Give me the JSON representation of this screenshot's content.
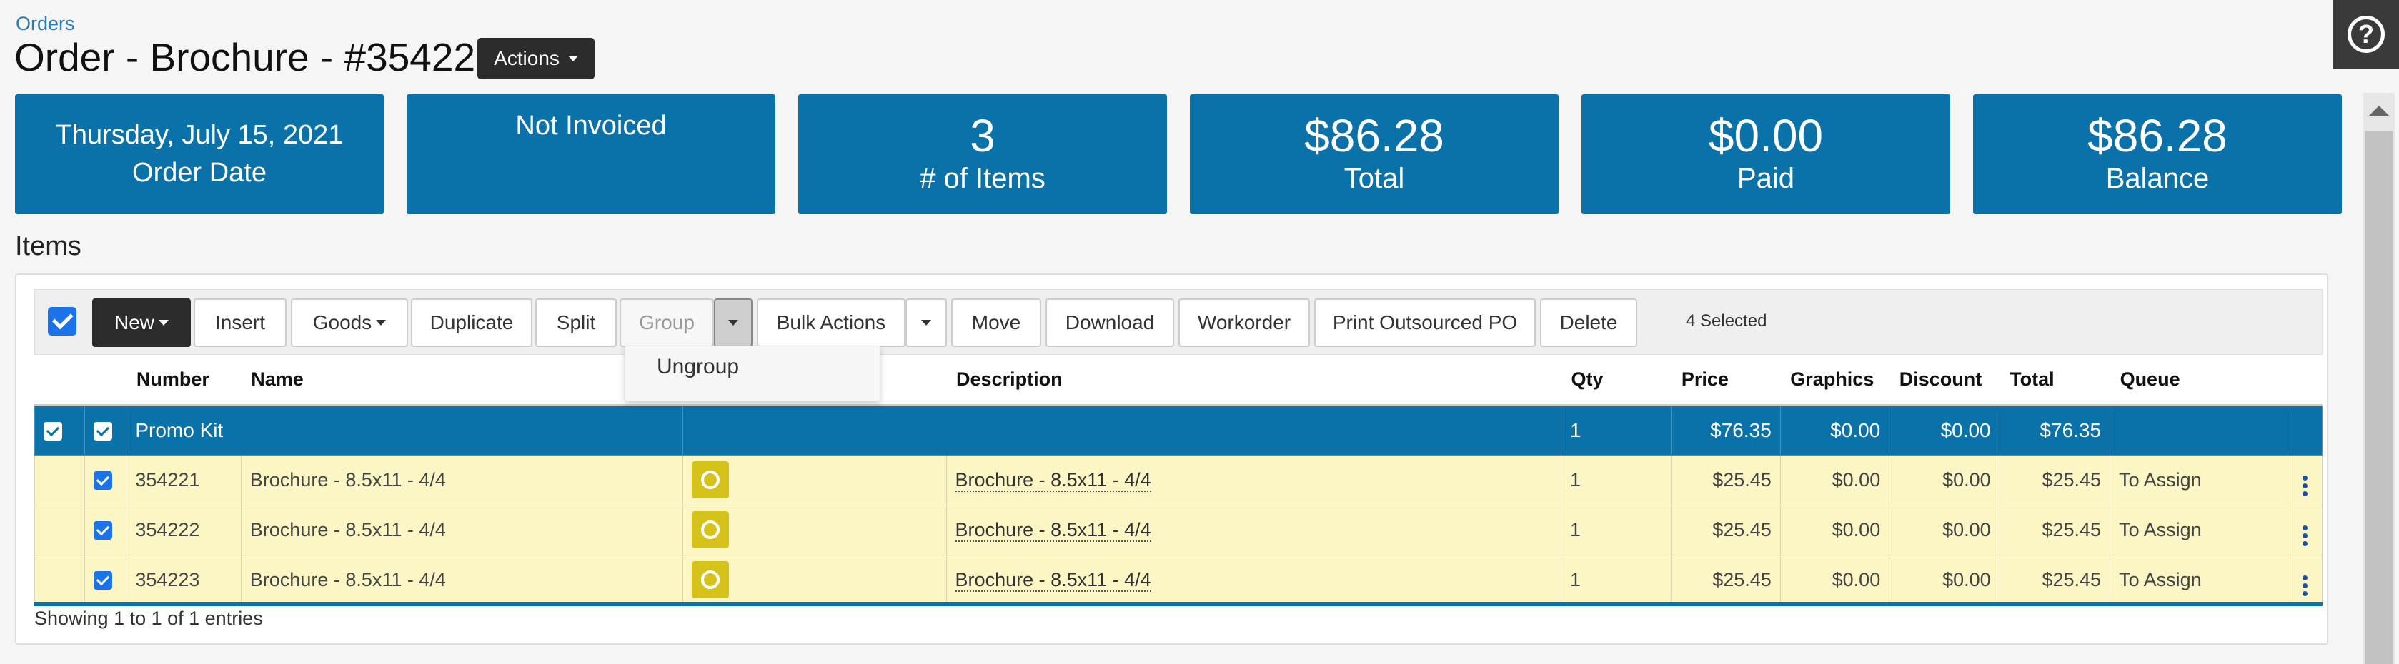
{
  "breadcrumb": "Orders",
  "title": "Order - Brochure - #35422",
  "actions_label": "Actions",
  "help_icon": "?",
  "stats": [
    {
      "line1": "Thursday, July 15, 2021",
      "line2": "Order Date"
    },
    {
      "line1": "Not Invoiced",
      "line2": ""
    },
    {
      "line1": "3",
      "line2": "# of Items"
    },
    {
      "line1": "$86.28",
      "line2": "Total"
    },
    {
      "line1": "$0.00",
      "line2": "Paid"
    },
    {
      "line1": "$86.28",
      "line2": "Balance"
    }
  ],
  "items_heading": "Items",
  "toolbar": {
    "new": "New",
    "insert": "Insert",
    "goods": "Goods",
    "duplicate": "Duplicate",
    "split": "Split",
    "group": "Group",
    "bulk_actions": "Bulk Actions",
    "move": "Move",
    "download": "Download",
    "workorder": "Workorder",
    "print_po": "Print Outsourced PO",
    "delete": "Delete",
    "selected": "4 Selected"
  },
  "dropdown": {
    "ungroup": "Ungroup"
  },
  "columns": {
    "number": "Number",
    "name": "Name",
    "description": "Description",
    "qty": "Qty",
    "price": "Price",
    "graphics": "Graphics",
    "discount": "Discount",
    "total": "Total",
    "queue": "Queue"
  },
  "group": {
    "name": "Promo Kit",
    "qty": "1",
    "price": "$76.35",
    "graphics": "$0.00",
    "discount": "$0.00",
    "total": "$76.35"
  },
  "rows": [
    {
      "number": "354221",
      "name": "Brochure - 8.5x11 - 4/4",
      "description": "Brochure - 8.5x11 - 4/4",
      "qty": "1",
      "price": "$25.45",
      "graphics": "$0.00",
      "discount": "$0.00",
      "total": "$25.45",
      "queue": "To Assign"
    },
    {
      "number": "354222",
      "name": "Brochure - 8.5x11 - 4/4",
      "description": "Brochure - 8.5x11 - 4/4",
      "qty": "1",
      "price": "$25.45",
      "graphics": "$0.00",
      "discount": "$0.00",
      "total": "$25.45",
      "queue": "To Assign"
    },
    {
      "number": "354223",
      "name": "Brochure - 8.5x11 - 4/4",
      "description": "Brochure - 8.5x11 - 4/4",
      "qty": "1",
      "price": "$25.45",
      "graphics": "$0.00",
      "discount": "$0.00",
      "total": "$25.45",
      "queue": "To Assign"
    }
  ],
  "footer": "Showing 1 to 1 of 1 entries"
}
